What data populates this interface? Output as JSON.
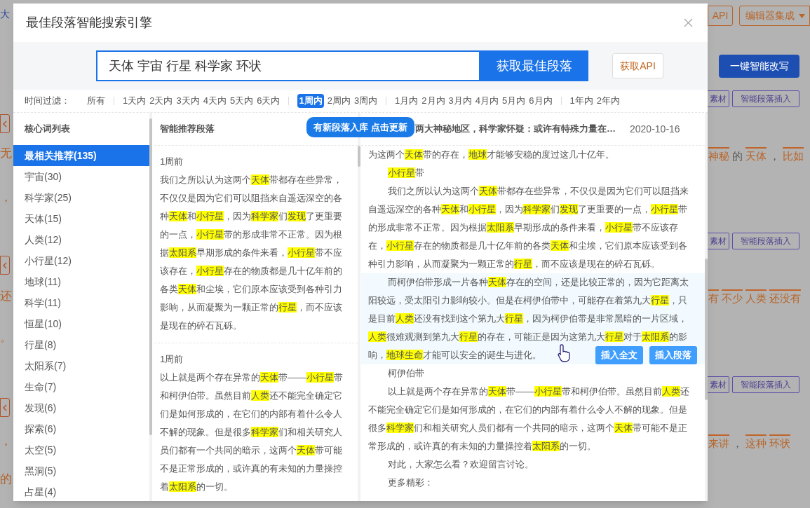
{
  "background_page": {
    "left_edge": [
      {
        "kind": "link",
        "text": "大"
      },
      {
        "kind": "nav_button"
      },
      {
        "kind": "text",
        "text": "无"
      },
      {
        "kind": "text",
        "text": "，"
      },
      {
        "kind": "nav_button"
      },
      {
        "kind": "text",
        "text": "还"
      },
      {
        "kind": "text",
        "text": "。"
      },
      {
        "kind": "nav_button"
      },
      {
        "kind": "text",
        "text": "，"
      },
      {
        "kind": "text",
        "text": "的"
      }
    ],
    "header_buttons": [
      "API",
      "编辑器集成"
    ],
    "rewrite_button": "一键智能改写",
    "sections": [
      {
        "tools": [
          "素材",
          "智能段落插入"
        ],
        "words": [
          {
            "text": "神秘",
            "keyword": true
          },
          {
            "text": "的",
            "keyword": false
          },
          {
            "text": "天体",
            "keyword": true
          },
          {
            "text": "，",
            "keyword": false
          },
          {
            "text": "比如",
            "keyword": true
          }
        ]
      },
      {
        "tools": [
          "素材",
          "智能段落插入"
        ],
        "words": [
          {
            "text": "有",
            "keyword": true
          },
          {
            "text": "不少",
            "keyword": true
          },
          {
            "text": "人类",
            "keyword": true
          },
          {
            "text": "还没有",
            "keyword": true
          }
        ]
      },
      {
        "tools": [
          "素材",
          "智能段落插入"
        ],
        "words": [
          {
            "text": "来讲",
            "keyword": true
          },
          {
            "text": "，",
            "keyword": false
          },
          {
            "text": "这种",
            "keyword": true
          },
          {
            "text": "环状",
            "keyword": true
          }
        ]
      }
    ]
  },
  "dialog": {
    "title": "最佳段落智能搜索引擎",
    "search": {
      "value": "天体 宇宙 行星 科学家 环状",
      "button": "获取最佳段落",
      "api_button": "获取API"
    },
    "time_filter": {
      "label": "时间过滤：",
      "groups": [
        [
          {
            "label": "所有",
            "selected": false
          }
        ],
        [
          {
            "label": "1天内",
            "selected": false
          },
          {
            "label": "2天内",
            "selected": false
          },
          {
            "label": "3天内",
            "selected": false
          },
          {
            "label": "4天内",
            "selected": false
          },
          {
            "label": "5天内",
            "selected": false
          },
          {
            "label": "6天内",
            "selected": false
          }
        ],
        [
          {
            "label": "1周内",
            "selected": true
          },
          {
            "label": "2周内",
            "selected": false
          },
          {
            "label": "3周内",
            "selected": false
          }
        ],
        [
          {
            "label": "1月内",
            "selected": false
          },
          {
            "label": "2月内",
            "selected": false
          },
          {
            "label": "3月内",
            "selected": false
          },
          {
            "label": "4月内",
            "selected": false
          },
          {
            "label": "5月内",
            "selected": false
          },
          {
            "label": "6月内",
            "selected": false
          }
        ],
        [
          {
            "label": "1年内",
            "selected": false
          },
          {
            "label": "2年内",
            "selected": false
          }
        ]
      ]
    },
    "update_tag": "有新段落入库 点击更新",
    "keywords": {
      "title": "核心词列表",
      "items": [
        {
          "label": "最相关推荐(135)",
          "selected": true
        },
        {
          "label": "宇宙(30)",
          "selected": false
        },
        {
          "label": "科学家(25)",
          "selected": false
        },
        {
          "label": "天体(15)",
          "selected": false
        },
        {
          "label": "人类(12)",
          "selected": false
        },
        {
          "label": "小行星(12)",
          "selected": false
        },
        {
          "label": "地球(11)",
          "selected": false
        },
        {
          "label": "科学(11)",
          "selected": false
        },
        {
          "label": "恒星(10)",
          "selected": false
        },
        {
          "label": "行星(8)",
          "selected": false
        },
        {
          "label": "太阳系(7)",
          "selected": false
        },
        {
          "label": "生命(7)",
          "selected": false
        },
        {
          "label": "发现(6)",
          "selected": false
        },
        {
          "label": "探索(6)",
          "selected": false
        },
        {
          "label": "太空(5)",
          "selected": false
        },
        {
          "label": "黑洞(5)",
          "selected": false
        },
        {
          "label": "占星(4)",
          "selected": false
        }
      ]
    },
    "recommended": {
      "title": "智能推荐段落",
      "cards": [
        {
          "age": "1周前",
          "segments": [
            {
              "text": "我们之所以认为这两个",
              "highlight": false
            },
            {
              "text": "天体",
              "highlight": true
            },
            {
              "text": "带都存在些异常，不仅仅是因为它们可以阻挡来自遥远深空的各种",
              "highlight": false
            },
            {
              "text": "天体",
              "highlight": true
            },
            {
              "text": "和",
              "highlight": false
            },
            {
              "text": "小行星",
              "highlight": true
            },
            {
              "text": "，因为",
              "highlight": false
            },
            {
              "text": "科学家",
              "highlight": true
            },
            {
              "text": "们",
              "highlight": false
            },
            {
              "text": "发现",
              "highlight": true
            },
            {
              "text": "了更重要的一点，",
              "highlight": false
            },
            {
              "text": "小行星",
              "highlight": true
            },
            {
              "text": "带的形成非常不正常。因为根据",
              "highlight": false
            },
            {
              "text": "太阳系",
              "highlight": true
            },
            {
              "text": "早期形成的条件来看，",
              "highlight": false
            },
            {
              "text": "小行星",
              "highlight": true
            },
            {
              "text": "带不应该存在，",
              "highlight": false
            },
            {
              "text": "小行星",
              "highlight": true
            },
            {
              "text": "存在的物质都是几十亿年前的各类",
              "highlight": false
            },
            {
              "text": "天体",
              "highlight": true
            },
            {
              "text": "和尘埃，它们原本应该受到各种引力影响，从而凝聚为一颗正常的",
              "highlight": false
            },
            {
              "text": "行星",
              "highlight": true
            },
            {
              "text": "，而不应该是现在的碎石瓦砾。",
              "highlight": false
            }
          ]
        },
        {
          "age": "1周前",
          "segments": [
            {
              "text": "以上就是两个存在异常的",
              "highlight": false
            },
            {
              "text": "天体",
              "highlight": true
            },
            {
              "text": "带——",
              "highlight": false
            },
            {
              "text": "小行星",
              "highlight": true
            },
            {
              "text": "带和柯伊伯带。虽然目前",
              "highlight": false
            },
            {
              "text": "人类",
              "highlight": true
            },
            {
              "text": "还不能完全确定它们是如何形成的，在它们的内部有着什么令人不解的现象。但是很多",
              "highlight": false
            },
            {
              "text": "科学家",
              "highlight": true
            },
            {
              "text": "们和相关研究人员们都有一个共同的暗示，这两个",
              "highlight": false
            },
            {
              "text": "天体",
              "highlight": true
            },
            {
              "text": "带可能不是正常形成的，或许真的有未知的力量操控着",
              "highlight": false
            },
            {
              "text": "太阳系",
              "highlight": true
            },
            {
              "text": "的一切。",
              "highlight": false
            }
          ]
        }
      ]
    },
    "article": {
      "title": "两大神秘地区，科学家怀疑：或许有特殊力量在…",
      "date": "2020-10-16",
      "hover_actions": [
        "插入全文",
        "插入段落"
      ],
      "paragraphs": [
        {
          "indent": false,
          "hovered": false,
          "segments": [
            {
              "text": "为这两个",
              "highlight": false
            },
            {
              "text": "天体",
              "highlight": true
            },
            {
              "text": "带的存在，",
              "highlight": false
            },
            {
              "text": "地球",
              "highlight": true
            },
            {
              "text": "才能够安稳的度过这几十亿年。",
              "highlight": false
            }
          ]
        },
        {
          "indent": true,
          "hovered": false,
          "segments": [
            {
              "text": "小行星",
              "highlight": true
            },
            {
              "text": "带",
              "highlight": false
            }
          ]
        },
        {
          "indent": true,
          "hovered": false,
          "segments": [
            {
              "text": "我们之所以认为这两个",
              "highlight": false
            },
            {
              "text": "天体",
              "highlight": true
            },
            {
              "text": "带都存在些异常，不仅仅是因为它们可以阻挡来自遥远深空的各种",
              "highlight": false
            },
            {
              "text": "天体",
              "highlight": true
            },
            {
              "text": "和",
              "highlight": false
            },
            {
              "text": "小行星",
              "highlight": true
            },
            {
              "text": "，因为",
              "highlight": false
            },
            {
              "text": "科学家",
              "highlight": true
            },
            {
              "text": "们",
              "highlight": false
            },
            {
              "text": "发现",
              "highlight": true
            },
            {
              "text": "了更重要的一点，",
              "highlight": false
            },
            {
              "text": "小行星",
              "highlight": true
            },
            {
              "text": "带的形成非常不正常。因为根据",
              "highlight": false
            },
            {
              "text": "太阳系",
              "highlight": true
            },
            {
              "text": "早期形成的条件来看，",
              "highlight": false
            },
            {
              "text": "小行星",
              "highlight": true
            },
            {
              "text": "带不应该存在，",
              "highlight": false
            },
            {
              "text": "小行星",
              "highlight": true
            },
            {
              "text": "存在的物质都是几十亿年前的各类",
              "highlight": false
            },
            {
              "text": "天体",
              "highlight": true
            },
            {
              "text": "和尘埃，它们原本应该受到各种引力影响，从而凝聚为一颗正常的",
              "highlight": false
            },
            {
              "text": "行星",
              "highlight": true
            },
            {
              "text": "，而不应该是现在的碎石瓦砾。",
              "highlight": false
            }
          ]
        },
        {
          "indent": true,
          "hovered": true,
          "segments": [
            {
              "text": "而柯伊伯带形成一片各种",
              "highlight": false
            },
            {
              "text": "天体",
              "highlight": true
            },
            {
              "text": "存在的空间，还是比较正常的，因为它距离太阳较远，受太阳引力影响较小。但是在柯伊伯带中，可能存在着第九大",
              "highlight": false
            },
            {
              "text": "行星",
              "highlight": true
            },
            {
              "text": "，只是目前",
              "highlight": false
            },
            {
              "text": "人类",
              "highlight": true
            },
            {
              "text": "还没有找到这个第九大",
              "highlight": false
            },
            {
              "text": "行星",
              "highlight": true
            },
            {
              "text": "，因为柯伊伯带是非常黑暗的一片区域，",
              "highlight": false
            },
            {
              "text": "人类",
              "highlight": true
            },
            {
              "text": "很难观测到第九大",
              "highlight": false
            },
            {
              "text": "行星",
              "highlight": true
            },
            {
              "text": "的存在，可能正是因为这第九大",
              "highlight": false
            },
            {
              "text": "行星",
              "highlight": true
            },
            {
              "text": "对于",
              "highlight": false
            },
            {
              "text": "太阳系",
              "highlight": true
            },
            {
              "text": "的影响，",
              "highlight": false
            },
            {
              "text": "地球生命",
              "highlight": true
            },
            {
              "text": "才能可以安全的诞生与进化。",
              "highlight": false
            }
          ]
        },
        {
          "indent": true,
          "hovered": false,
          "segments": [
            {
              "text": "柯伊伯带",
              "highlight": false
            }
          ]
        },
        {
          "indent": true,
          "hovered": false,
          "segments": [
            {
              "text": "以上就是两个存在异常的",
              "highlight": false
            },
            {
              "text": "天体",
              "highlight": true
            },
            {
              "text": "带——",
              "highlight": false
            },
            {
              "text": "小行星",
              "highlight": true
            },
            {
              "text": "带和柯伊伯带。虽然目前",
              "highlight": false
            },
            {
              "text": "人类",
              "highlight": true
            },
            {
              "text": "还不能完全确定它们是如何形成的，在它们的内部有着什么令人不解的现象。但是很多",
              "highlight": false
            },
            {
              "text": "科学家",
              "highlight": true
            },
            {
              "text": "们和相关研究人员们都有一个共同的暗示，这两个",
              "highlight": false
            },
            {
              "text": "天体",
              "highlight": true
            },
            {
              "text": "带可能不是正常形成的，或许真的有未知的力量操控着",
              "highlight": false
            },
            {
              "text": "太阳系",
              "highlight": true
            },
            {
              "text": "的一切。",
              "highlight": false
            }
          ]
        },
        {
          "indent": true,
          "hovered": false,
          "segments": [
            {
              "text": "对此，大家怎么看？欢迎留言讨论。",
              "highlight": false
            }
          ]
        },
        {
          "indent": true,
          "hovered": false,
          "segments": [
            {
              "text": "更多精彩：",
              "highlight": false
            }
          ]
        }
      ]
    }
  }
}
